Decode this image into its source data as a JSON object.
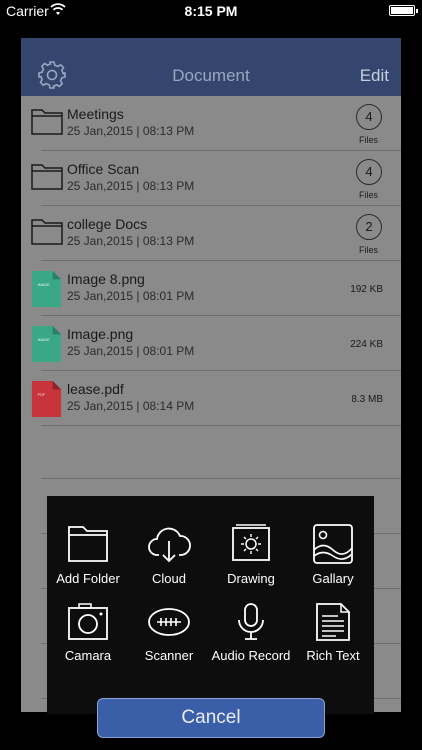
{
  "status": {
    "carrier": "Carrier",
    "time": "8:15 PM"
  },
  "nav": {
    "title": "Document",
    "edit_label": "Edit"
  },
  "items": [
    {
      "type": "folder",
      "name": "Meetings",
      "date": "25 Jan,2015 | 08:13 PM",
      "count": "4",
      "count_label": "Files"
    },
    {
      "type": "folder",
      "name": "Office Scan",
      "date": "25 Jan,2015 | 08:13 PM",
      "count": "4",
      "count_label": "Files"
    },
    {
      "type": "folder",
      "name": "college Docs",
      "date": "25 Jan,2015 | 08:13 PM",
      "count": "2",
      "count_label": "Files"
    },
    {
      "type": "image",
      "name": "Image 8.png",
      "date": "25 Jan,2015 | 08:01 PM",
      "size": "192 KB",
      "thumb_label": "IMAGE"
    },
    {
      "type": "image",
      "name": "Image.png",
      "date": "25 Jan,2015 | 08:01 PM",
      "size": "224 KB",
      "thumb_label": "IMAGE"
    },
    {
      "type": "pdf",
      "name": "lease.pdf",
      "date": "25 Jan,2015 | 08:14 PM",
      "size": "8.3 MB",
      "thumb_label": "PDF"
    }
  ],
  "actions": [
    {
      "label": "Add Folder",
      "icon": "folder-icon"
    },
    {
      "label": "Cloud",
      "icon": "cloud-download-icon"
    },
    {
      "label": "Drawing",
      "icon": "drawing-icon"
    },
    {
      "label": "Gallary",
      "icon": "gallery-icon"
    },
    {
      "label": "Camara",
      "icon": "camera-icon"
    },
    {
      "label": "Scanner",
      "icon": "scanner-icon"
    },
    {
      "label": "Audio Record",
      "icon": "microphone-icon"
    },
    {
      "label": "Rich Text",
      "icon": "rich-text-icon"
    }
  ],
  "cancel_label": "Cancel",
  "colors": {
    "navbar": "#34466e",
    "image_thumb": "#3aa887",
    "pdf_thumb": "#c8343c",
    "cancel": "#3b5ea8"
  }
}
